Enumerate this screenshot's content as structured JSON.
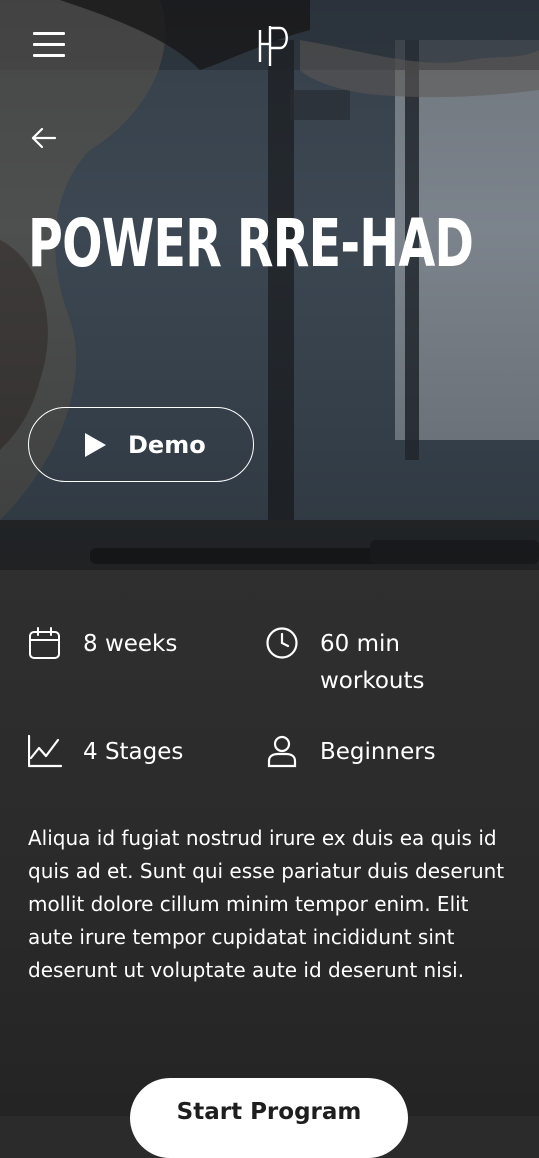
{
  "header": {
    "menu_icon": "hamburger-menu-icon",
    "logo_icon": "brand-logo-icon",
    "back_icon": "arrow-left-icon"
  },
  "hero": {
    "title": "POWER RRE-HAD",
    "demo_label": "Demo",
    "demo_icon": "play-icon"
  },
  "stats": [
    {
      "icon": "calendar-icon",
      "line1": "8 weeks",
      "line2": ""
    },
    {
      "icon": "clock-icon",
      "line1": "60 min",
      "line2": "workouts"
    },
    {
      "icon": "chart-line-icon",
      "line1": "4 Stages",
      "line2": ""
    },
    {
      "icon": "user-icon",
      "line1": "Beginners",
      "line2": ""
    }
  ],
  "description": "Aliqua id fugiat nostrud irure ex duis ea quis id quis ad et. Sunt qui esse pariatur duis deserunt mollit dolore cillum minim tempor enim. Elit aute irure tempor cupidatat incididunt sint deserunt ut voluptate aute id deserunt nisi.",
  "cta": {
    "label": "Start Program"
  },
  "colors": {
    "background": "#2b2b2b",
    "text": "#ffffff",
    "button_bg": "#ffffff",
    "button_text": "#1e1e1e"
  }
}
